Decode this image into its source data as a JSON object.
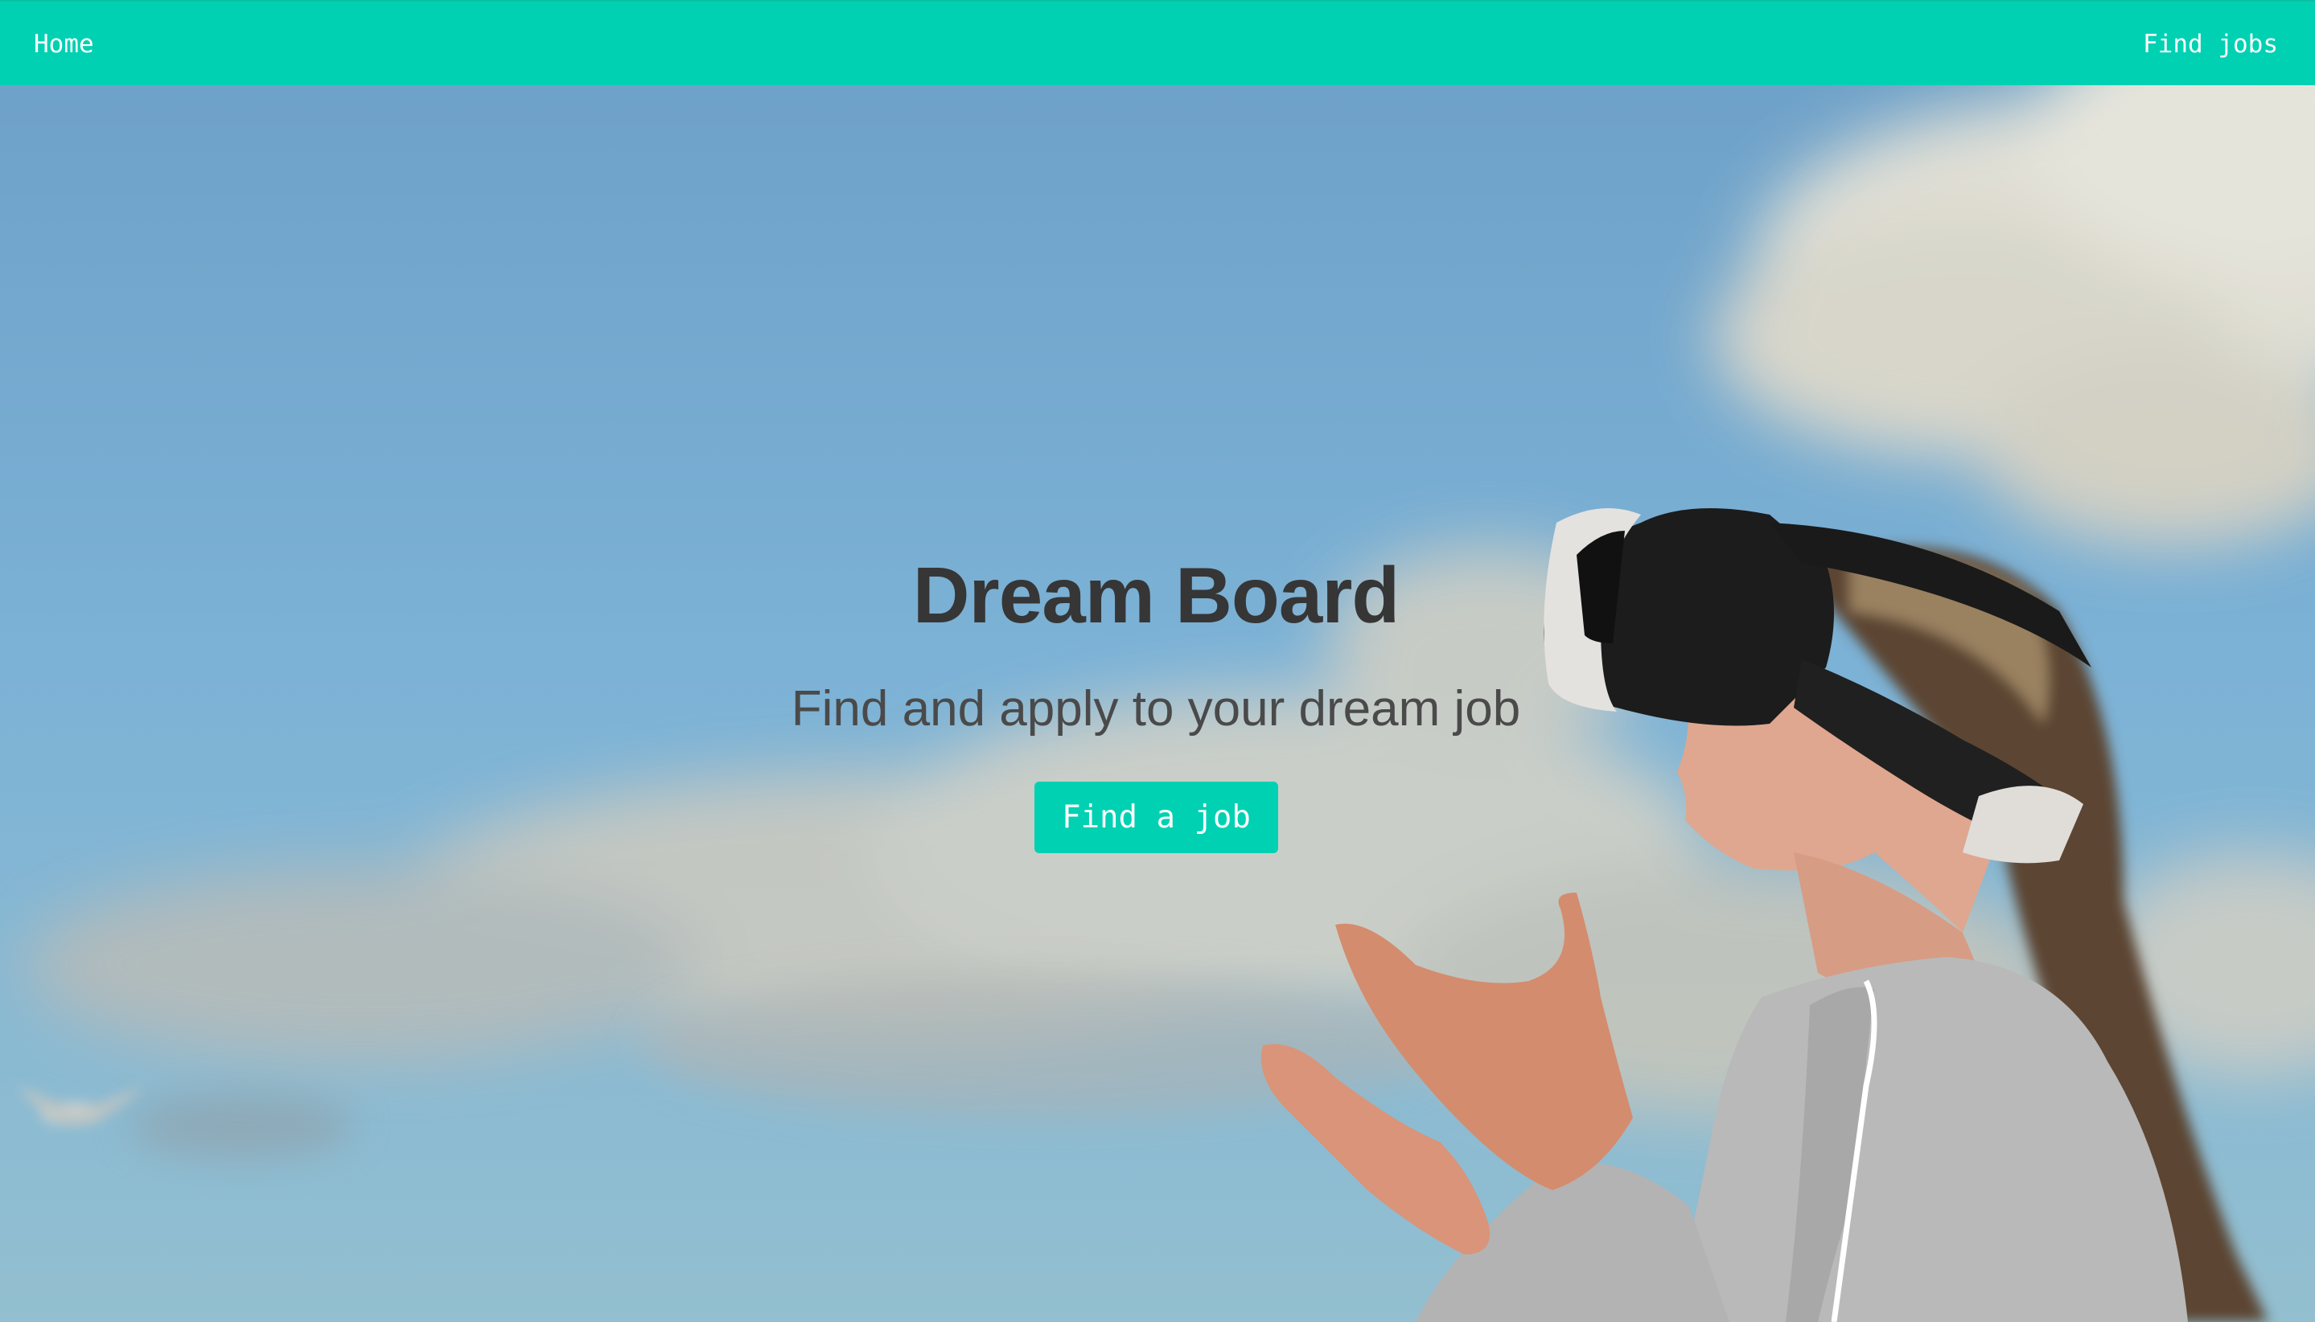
{
  "navbar": {
    "home_label": "Home",
    "find_jobs_label": "Find jobs",
    "background_color": "#00d1b2"
  },
  "hero": {
    "title": "Dream Board",
    "subtitle": "Find and apply to your dream job",
    "cta_label": "Find a job",
    "cta_color": "#00d1b2",
    "background_image": "photo-woman-vr-headset-sky"
  }
}
